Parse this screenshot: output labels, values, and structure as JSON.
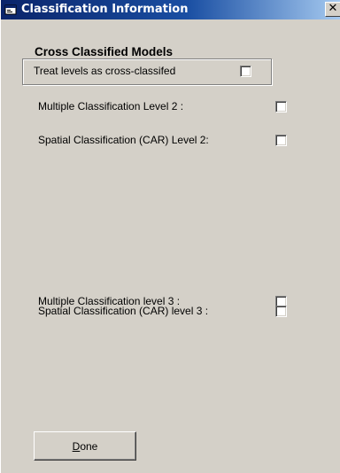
{
  "window": {
    "title": "Classification Information",
    "close_glyph": "✕",
    "icon": "window-app-icon"
  },
  "cross_classified": {
    "group_title": "Cross Classified Models",
    "treat_label": "Treat levels as cross-classifed",
    "treat_checked": false
  },
  "level2": {
    "multiple_label": "Multiple Classification Level 2 :",
    "multiple_checked": false,
    "spatial_label": "Spatial Classification (CAR) Level 2:",
    "spatial_checked": false
  },
  "level3": {
    "multiple_label": "Multiple Classification level 3 :",
    "multiple_checked": false,
    "spatial_label": "Spatial Classification (CAR) level 3 :",
    "spatial_checked": false
  },
  "done_button": {
    "mnemonic": "D",
    "rest": "one"
  }
}
